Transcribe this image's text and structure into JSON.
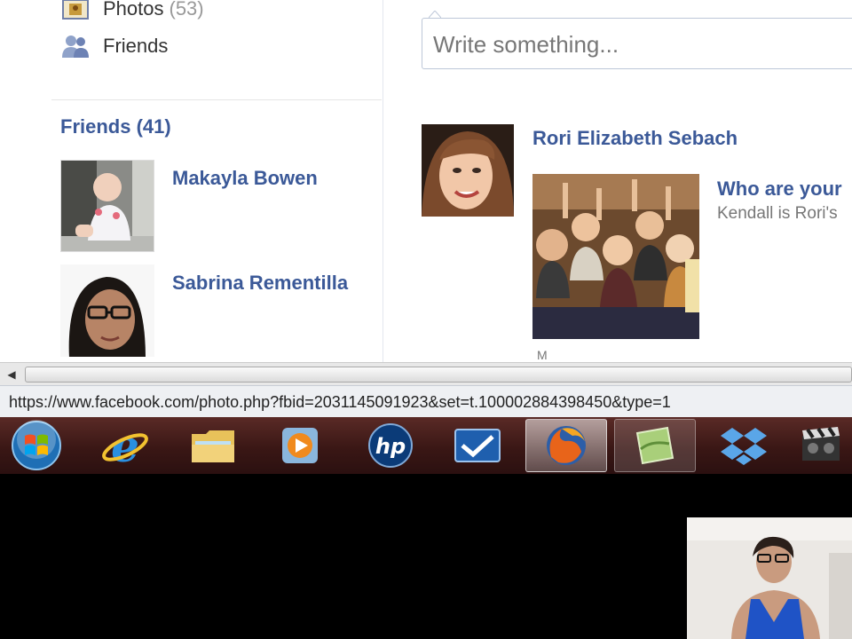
{
  "left_nav": {
    "photos_label": "Photos",
    "photos_count": "(53)",
    "friends_label": "Friends"
  },
  "friends_section": {
    "heading": "Friends (41)",
    "items": [
      {
        "name": "Makayla Bowen"
      },
      {
        "name": "Sabrina Rementilla"
      }
    ]
  },
  "composer": {
    "placeholder": "Write something..."
  },
  "post": {
    "author": "Rori Elizabeth Sebach",
    "question": "Who are your",
    "subtext": "Kendall is Rori's",
    "more": "M"
  },
  "statusbar": {
    "url": "https://www.facebook.com/photo.php?fbid=2031145091923&set=t.100002884398450&type=1"
  },
  "taskbar": {
    "items": [
      "windows-start",
      "internet-explorer",
      "file-explorer",
      "media-player",
      "hp",
      "checkmark-app",
      "firefox",
      "green-app",
      "dropbox",
      "video-editor"
    ]
  },
  "colors": {
    "link_blue": "#3b5998",
    "taskbar": "#3a1715"
  }
}
